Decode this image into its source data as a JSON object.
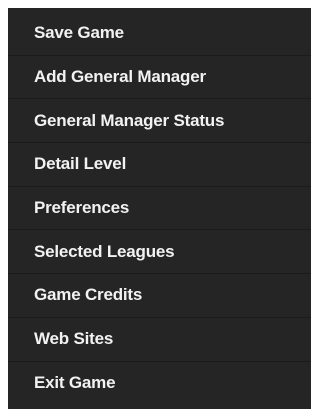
{
  "menu": {
    "items": [
      {
        "label": "Save Game"
      },
      {
        "label": "Add General Manager"
      },
      {
        "label": "General Manager Status"
      },
      {
        "label": "Detail Level"
      },
      {
        "label": "Preferences"
      },
      {
        "label": "Selected Leagues"
      },
      {
        "label": "Game Credits"
      },
      {
        "label": "Web Sites"
      },
      {
        "label": "Exit Game"
      }
    ]
  }
}
